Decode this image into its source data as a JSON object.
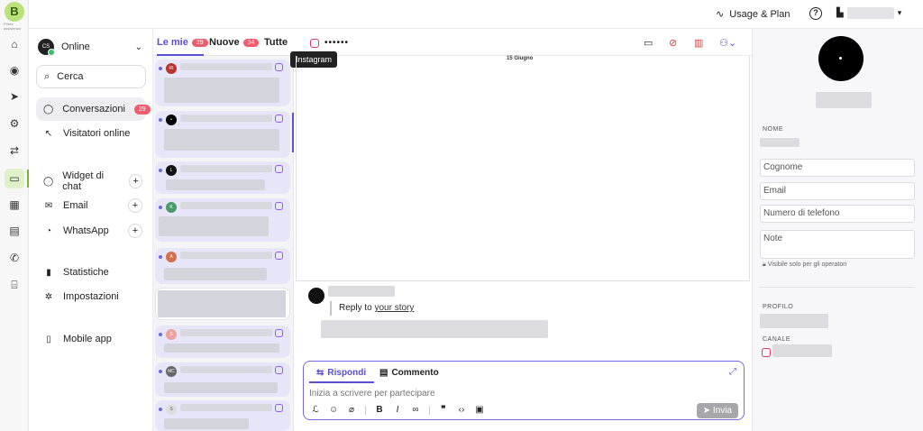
{
  "app": {
    "logo_letter": "B",
    "logo_sub": "Prima assistenza"
  },
  "rail": {
    "icons": [
      "home-icon",
      "contacts-icon",
      "send-icon",
      "automation-icon",
      "sync-icon",
      "chat-icon",
      "board-icon",
      "calendar-icon",
      "phone-icon",
      "bank-icon"
    ]
  },
  "topbar": {
    "usage_label": "Usage & Plan",
    "help_label": "?"
  },
  "sidebar": {
    "status": {
      "initials": "CS",
      "label": "Online"
    },
    "search_label": "Cerca",
    "items": [
      {
        "label": "Conversazioni",
        "badge": "29"
      },
      {
        "label": "Visitatori online"
      },
      {
        "label": "Widget di chat"
      },
      {
        "label": "Email"
      },
      {
        "label": "WhatsApp"
      },
      {
        "label": "Statistiche"
      },
      {
        "label": "Impostazioni"
      },
      {
        "label": "Mobile app"
      }
    ],
    "plus": "+"
  },
  "list": {
    "tabs": [
      {
        "label": "Le mie",
        "count": "29"
      },
      {
        "label": "Nuove",
        "count": "34"
      },
      {
        "label": "Tutte"
      }
    ],
    "cards": [
      {
        "initials": "RI",
        "color": "#b8342c"
      },
      {
        "initials": "•",
        "color": "#000000"
      },
      {
        "initials": "L",
        "color": "#111111"
      },
      {
        "initials": "K",
        "color": "#4a9a6a"
      },
      {
        "initials": "A",
        "color": "#d4704a"
      },
      {
        "initials": "",
        "color": "#ffffff"
      },
      {
        "initials": "S",
        "color": "#f0a0a0"
      },
      {
        "initials": "MC",
        "color": "#666666"
      },
      {
        "initials": "S",
        "color": "#dddddd"
      }
    ]
  },
  "chat": {
    "channel_name": "••••••",
    "tooltip": "Instagram",
    "date": "15 Giugno",
    "reply_prefix": "Reply to",
    "reply_link": "your story",
    "composer": {
      "tab_reply": "Rispondi",
      "tab_comment": "Commento",
      "placeholder": "Inizia a scrivere per partecipare",
      "send_label": "Invia"
    }
  },
  "contact": {
    "name_label": "NOME",
    "surname_placeholder": "Cognome",
    "email_placeholder": "Email",
    "phone_placeholder": "Numero di telefono",
    "note_placeholder": "Note",
    "visibility_note": "Visibile solo per gli operatori",
    "profile_label": "PROFILO",
    "channel_label": "CANALE"
  }
}
